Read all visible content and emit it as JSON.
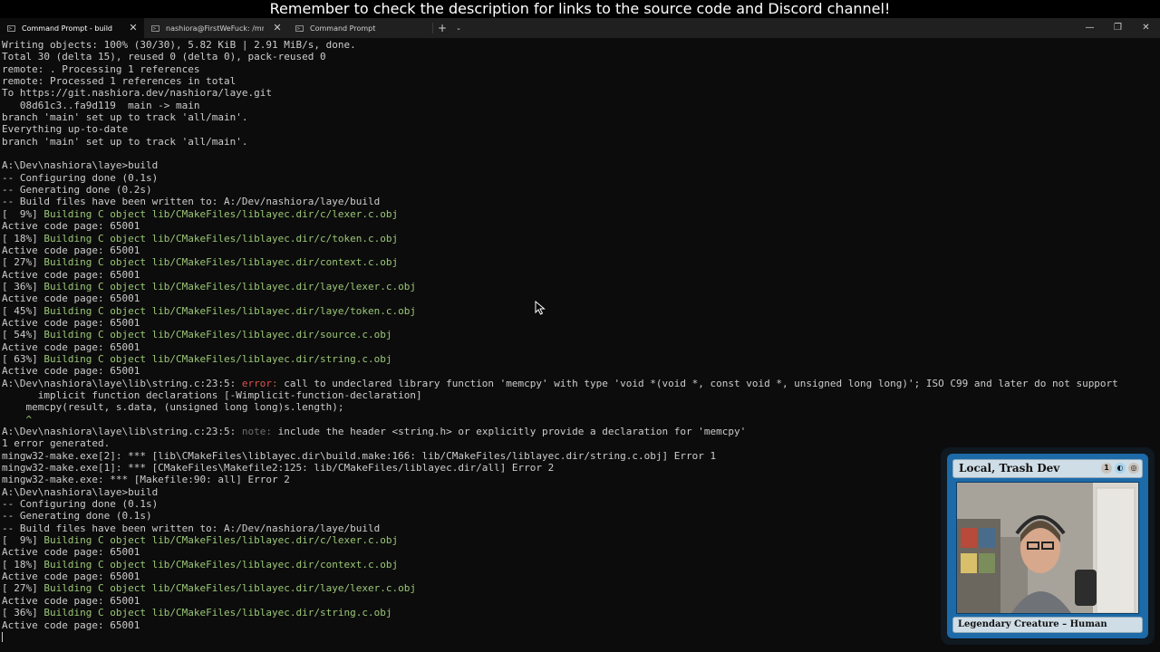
{
  "banner": {
    "text": "Remember to check the description for links to the source code and Discord channel!"
  },
  "tabs": [
    {
      "label": "Command Prompt - build",
      "icon": "terminal-icon",
      "active": true
    },
    {
      "label": "nashiora@FirstWeFuck: /mnt/a",
      "icon": "terminal-icon",
      "active": false
    },
    {
      "label": "Command Prompt",
      "icon": "terminal-icon",
      "active": false
    }
  ],
  "tab_close_glyph": "✕",
  "new_tab_glyph": "+",
  "dropdown_glyph": "⌄",
  "window_controls": {
    "minimize": "—",
    "maximize": "❐",
    "close": "✕"
  },
  "terminal": {
    "lines": [
      [
        {
          "t": "Writing objects: 100% (30/30), 5.82 KiB | 2.91 MiB/s, done.",
          "c": "default"
        }
      ],
      [
        {
          "t": "Total 30 (delta 15), reused 0 (delta 0), pack-reused 0",
          "c": "default"
        }
      ],
      [
        {
          "t": "remote: . Processing 1 references",
          "c": "default"
        }
      ],
      [
        {
          "t": "remote: Processed 1 references in total",
          "c": "default"
        }
      ],
      [
        {
          "t": "To https://git.nashiora.dev/nashiora/laye.git",
          "c": "default"
        }
      ],
      [
        {
          "t": "   08d61c3..fa9d119  main -> main",
          "c": "default"
        }
      ],
      [
        {
          "t": "branch 'main' set up to track 'all/main'.",
          "c": "default"
        }
      ],
      [
        {
          "t": "Everything up-to-date",
          "c": "default"
        }
      ],
      [
        {
          "t": "branch 'main' set up to track 'all/main'.",
          "c": "default"
        }
      ],
      [
        {
          "t": "",
          "c": "default"
        }
      ],
      [
        {
          "t": "A:\\Dev\\nashiora\\laye>build",
          "c": "default"
        }
      ],
      [
        {
          "t": "-- Configuring done (0.1s)",
          "c": "default"
        }
      ],
      [
        {
          "t": "-- Generating done (0.2s)",
          "c": "default"
        }
      ],
      [
        {
          "t": "-- Build files have been written to: A:/Dev/nashiora/laye/build",
          "c": "default"
        }
      ],
      [
        {
          "t": "[  9%] ",
          "c": "default"
        },
        {
          "t": "Building C object lib/CMakeFiles/liblayec.dir/c/lexer.c.obj",
          "c": "green"
        }
      ],
      [
        {
          "t": "Active code page: 65001",
          "c": "default"
        }
      ],
      [
        {
          "t": "[ 18%] ",
          "c": "default"
        },
        {
          "t": "Building C object lib/CMakeFiles/liblayec.dir/c/token.c.obj",
          "c": "green"
        }
      ],
      [
        {
          "t": "Active code page: 65001",
          "c": "default"
        }
      ],
      [
        {
          "t": "[ 27%] ",
          "c": "default"
        },
        {
          "t": "Building C object lib/CMakeFiles/liblayec.dir/context.c.obj",
          "c": "green"
        }
      ],
      [
        {
          "t": "Active code page: 65001",
          "c": "default"
        }
      ],
      [
        {
          "t": "[ 36%] ",
          "c": "default"
        },
        {
          "t": "Building C object lib/CMakeFiles/liblayec.dir/laye/lexer.c.obj",
          "c": "green"
        }
      ],
      [
        {
          "t": "Active code page: 65001",
          "c": "default"
        }
      ],
      [
        {
          "t": "[ 45%] ",
          "c": "default"
        },
        {
          "t": "Building C object lib/CMakeFiles/liblayec.dir/laye/token.c.obj",
          "c": "green"
        }
      ],
      [
        {
          "t": "Active code page: 65001",
          "c": "default"
        }
      ],
      [
        {
          "t": "[ 54%] ",
          "c": "default"
        },
        {
          "t": "Building C object lib/CMakeFiles/liblayec.dir/source.c.obj",
          "c": "green"
        }
      ],
      [
        {
          "t": "Active code page: 65001",
          "c": "default"
        }
      ],
      [
        {
          "t": "[ 63%] ",
          "c": "default"
        },
        {
          "t": "Building C object lib/CMakeFiles/liblayec.dir/string.c.obj",
          "c": "green"
        }
      ],
      [
        {
          "t": "Active code page: 65001",
          "c": "default"
        }
      ],
      [
        {
          "t": "A:\\Dev\\nashiora\\laye\\lib\\string.c:23:5: ",
          "c": "default"
        },
        {
          "t": "error: ",
          "c": "red"
        },
        {
          "t": "call to undeclared library function 'memcpy' with type 'void *(void *, const void *, unsigned long long)'; ISO C99 and later do not support",
          "c": "default"
        }
      ],
      [
        {
          "t": "      implicit function declarations [-Wimplicit-function-declaration]",
          "c": "default"
        }
      ],
      [
        {
          "t": "    memcpy(result, s.data, (unsigned long long)s.length);",
          "c": "default"
        }
      ],
      [
        {
          "t": "    ^",
          "c": "green"
        }
      ],
      [
        {
          "t": "A:\\Dev\\nashiora\\laye\\lib\\string.c:23:5: ",
          "c": "default"
        },
        {
          "t": "note: ",
          "c": "gray"
        },
        {
          "t": "include the header <string.h> or explicitly provide a declaration for 'memcpy'",
          "c": "default"
        }
      ],
      [
        {
          "t": "1 error generated.",
          "c": "default"
        }
      ],
      [
        {
          "t": "mingw32-make.exe[2]: *** [lib\\CMakeFiles\\liblayec.dir\\build.make:166: lib/CMakeFiles/liblayec.dir/string.c.obj] Error 1",
          "c": "default"
        }
      ],
      [
        {
          "t": "mingw32-make.exe[1]: *** [CMakeFiles\\Makefile2:125: lib/CMakeFiles/liblayec.dir/all] Error 2",
          "c": "default"
        }
      ],
      [
        {
          "t": "mingw32-make.exe: *** [Makefile:90: all] Error 2",
          "c": "default"
        }
      ],
      [
        {
          "t": "A:\\Dev\\nashiora\\laye>build",
          "c": "default"
        }
      ],
      [
        {
          "t": "-- Configuring done (0.1s)",
          "c": "default"
        }
      ],
      [
        {
          "t": "-- Generating done (0.1s)",
          "c": "default"
        }
      ],
      [
        {
          "t": "-- Build files have been written to: A:/Dev/nashiora/laye/build",
          "c": "default"
        }
      ],
      [
        {
          "t": "[  9%] ",
          "c": "default"
        },
        {
          "t": "Building C object lib/CMakeFiles/liblayec.dir/c/lexer.c.obj",
          "c": "green"
        }
      ],
      [
        {
          "t": "Active code page: 65001",
          "c": "default"
        }
      ],
      [
        {
          "t": "[ 18%] ",
          "c": "default"
        },
        {
          "t": "Building C object lib/CMakeFiles/liblayec.dir/context.c.obj",
          "c": "green"
        }
      ],
      [
        {
          "t": "Active code page: 65001",
          "c": "default"
        }
      ],
      [
        {
          "t": "[ 27%] ",
          "c": "default"
        },
        {
          "t": "Building C object lib/CMakeFiles/liblayec.dir/laye/lexer.c.obj",
          "c": "green"
        }
      ],
      [
        {
          "t": "Active code page: 65001",
          "c": "default"
        }
      ],
      [
        {
          "t": "[ 36%] ",
          "c": "default"
        },
        {
          "t": "Building C object lib/CMakeFiles/liblayec.dir/string.c.obj",
          "c": "green"
        }
      ],
      [
        {
          "t": "Active code page: 65001",
          "c": "default"
        }
      ]
    ]
  },
  "webcam_card": {
    "name": "Local, Trash Dev",
    "mana": [
      "1",
      "◐",
      "◎"
    ],
    "type_line": "Legendary Creature – Human"
  },
  "colors": {
    "terminal_bg": "#0c0c0c",
    "text": "#cccccc",
    "green": "#9ac776",
    "red": "#e0524a",
    "gray": "#6e6e6e",
    "card_frame": "#1c6aa8"
  }
}
